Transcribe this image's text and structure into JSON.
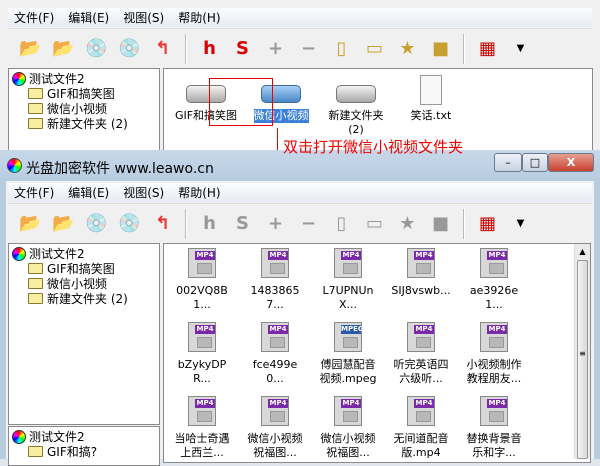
{
  "menu": [
    "文件(F)",
    "编辑(E)",
    "视图(S)",
    "帮助(H)"
  ],
  "back_window": {
    "tree": {
      "root": "测试文件2",
      "children": [
        "GIF和搞笑图",
        "微信小视频",
        "新建文件夹 (2)"
      ]
    },
    "items": [
      {
        "label": "GIF和搞笑图",
        "icon": "drive-icon"
      },
      {
        "label": "微信小视频",
        "icon": "drive-icon",
        "selected": true
      },
      {
        "label": "新建文件夹\n(2)",
        "icon": "drive-icon"
      },
      {
        "label": "笑话.txt",
        "icon": "text-file-icon"
      }
    ]
  },
  "annotation": "双击打开微信小视频文件夹",
  "annotation_color": "#ff0000",
  "front_window": {
    "title": "光盘加密软件 www.leawo.cn",
    "buttons": {
      "minimize": "–",
      "maximize": "□",
      "close": "X"
    },
    "tree": {
      "root": "测试文件2",
      "children": [
        "GIF和搞笑图",
        "微信小视频",
        "新建文件夹 (2)"
      ]
    },
    "tree2": {
      "root": "测试文件2",
      "children": [
        "GIF和搞?"
      ]
    },
    "files": [
      {
        "label": "002VQ8B1...",
        "type": "MP4"
      },
      {
        "label": "14838657...",
        "type": "MP4"
      },
      {
        "label": "L7UPNUnX...",
        "type": "MP4"
      },
      {
        "label": "SIJ8vswb...",
        "type": "MP4"
      },
      {
        "label": "ae3926e1...",
        "type": "MP4"
      },
      {
        "label": "bZykyDPR...",
        "type": "MP4"
      },
      {
        "label": "fce499e0...",
        "type": "MP4"
      },
      {
        "label": "傅园慧配音视频.mpeg",
        "type": "MPEG"
      },
      {
        "label": "听完英语四六级听...",
        "type": "MP4"
      },
      {
        "label": "小视频制作教程朋友...",
        "type": "MP4"
      },
      {
        "label": "当哈士奇遇上西兰...",
        "type": "MP4"
      },
      {
        "label": "微信小视频祝福图...",
        "type": "MP4"
      },
      {
        "label": "微信小视频祝福图...",
        "type": "MP4"
      },
      {
        "label": "无间道配音版.mp4",
        "type": "MP4"
      },
      {
        "label": "替换背景音乐和字...",
        "type": "MP4"
      }
    ]
  },
  "toolbar": [
    "import-folder",
    "export-folder",
    "encrypt-disc",
    "burn-disc",
    "up-level",
    "find-hidden",
    "find-s",
    "add-key",
    "remove-key",
    "key-file",
    "key-folder",
    "key-favorite",
    "key-stop",
    "view-grid",
    "view-dropdown"
  ]
}
